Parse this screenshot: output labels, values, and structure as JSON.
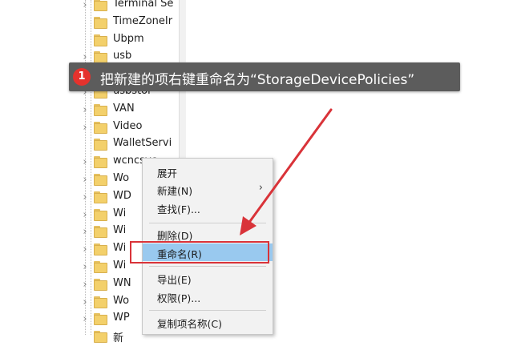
{
  "tree": {
    "items": [
      {
        "label": "Terminal Se",
        "chevron": true
      },
      {
        "label": "TimeZoneIr",
        "chevron": false
      },
      {
        "label": "Ubpm",
        "chevron": false
      },
      {
        "label": "usb",
        "chevron": true
      },
      {
        "label": "",
        "chevron": false
      },
      {
        "label": "usbstor",
        "chevron": true
      },
      {
        "label": "VAN",
        "chevron": true
      },
      {
        "label": "Video",
        "chevron": true
      },
      {
        "label": "WalletServi",
        "chevron": false
      },
      {
        "label": "wcncsvc",
        "chevron": true
      },
      {
        "label": "Wo",
        "chevron": true
      },
      {
        "label": "WD",
        "chevron": true
      },
      {
        "label": "Wi",
        "chevron": true
      },
      {
        "label": "Wi",
        "chevron": true
      },
      {
        "label": "Wi",
        "chevron": true
      },
      {
        "label": "Wi",
        "chevron": true
      },
      {
        "label": "WN",
        "chevron": true
      },
      {
        "label": "Wo",
        "chevron": true
      },
      {
        "label": "WP",
        "chevron": true
      },
      {
        "label": "新",
        "chevron": false
      }
    ]
  },
  "callout": {
    "step": "1",
    "text": "把新建的项右键重命名为“StorageDevicePolicies”"
  },
  "context_menu": {
    "expand": "展开",
    "new": "新建(N)",
    "find": "查找(F)...",
    "delete": "删除(D)",
    "rename": "重命名(R)",
    "export": "导出(E)",
    "permissions": "权限(P)...",
    "copy_key_name": "复制项名称(C)"
  },
  "colors": {
    "highlight": "#99c9ef",
    "annotation_red": "#d93339",
    "badge_red": "#e5322d",
    "callout_bg": "#5c5c5c",
    "folder": "#f3d06b"
  },
  "icons": [
    "chevron-right-icon",
    "folder-icon",
    "submenu-arrow-icon",
    "step-badge",
    "pointer-arrow"
  ]
}
